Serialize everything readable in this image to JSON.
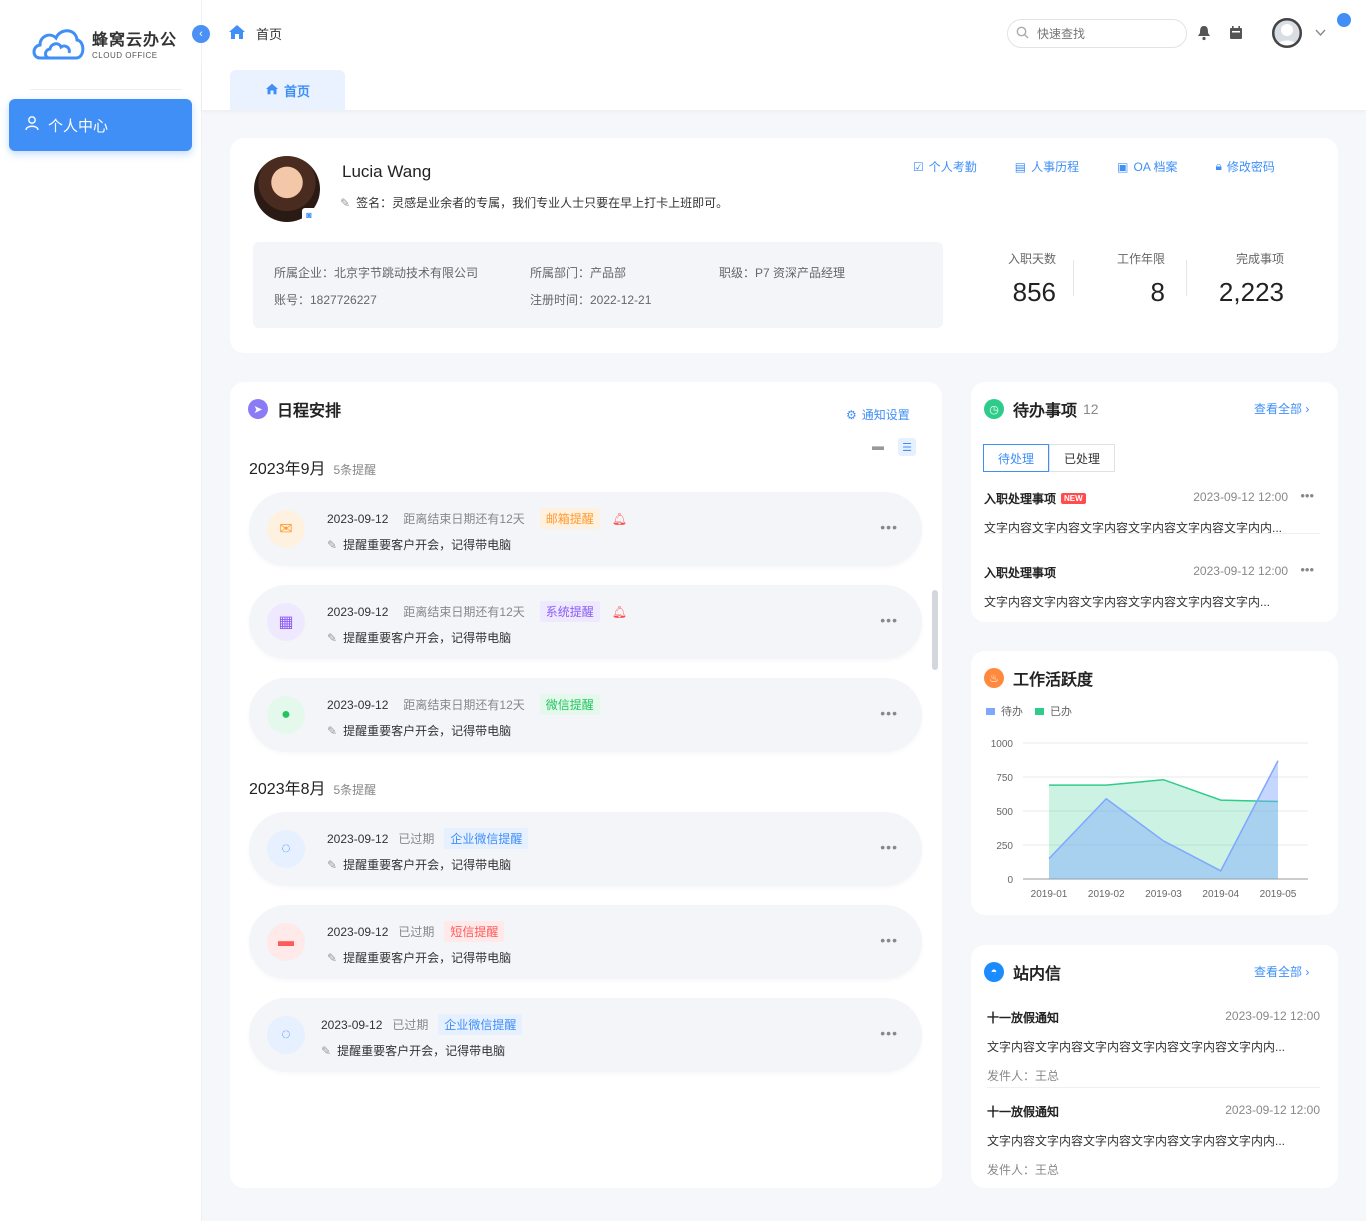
{
  "app": {
    "name_cn": "蜂窝云办公",
    "name_en": "CLOUD OFFICE"
  },
  "sidebar": {
    "items": [
      {
        "label": "个人中心",
        "icon": "user-icon",
        "active": true
      }
    ]
  },
  "header": {
    "breadcrumb": "首页",
    "search_placeholder": "快速查找"
  },
  "tabs": [
    {
      "label": "首页",
      "active": true
    }
  ],
  "profile": {
    "name": "Lucia Wang",
    "signature": "签名：灵感是业余者的专属，我们专业人士只要在早上打卡上班即可。",
    "links": [
      "个人考勤",
      "人事历程",
      "OA 档案",
      "修改密码"
    ],
    "company": "所属企业：北京字节跳动技术有限公司",
    "department": "所属部门：产品部",
    "rank": "职级：P7 资深产品经理",
    "account": "账号：1827726227",
    "register": "注册时间：2022-12-21",
    "stats": [
      {
        "label": "入职天数",
        "value": "856"
      },
      {
        "label": "工作年限",
        "value": "8"
      },
      {
        "label": "完成事项",
        "value": "2,223"
      }
    ]
  },
  "schedule": {
    "title": "日程安排",
    "notify_label": "通知设置",
    "months": [
      {
        "title": "2023年9月",
        "count": "5条提醒"
      },
      {
        "title": "2023年8月",
        "count": "5条提醒"
      }
    ],
    "events": [
      {
        "date": "2023-09-12",
        "status": "距离结束日期还有12天",
        "tag": "邮箱提醒",
        "note": "提醒重要客户开会，记得带电脑",
        "icon": "mail-icon",
        "alarm": true,
        "color": "#ff9a2e"
      },
      {
        "date": "2023-09-12",
        "status": "距离结束日期还有12天",
        "tag": "系统提醒",
        "note": "提醒重要客户开会，记得带电脑",
        "icon": "apps-icon",
        "alarm": true,
        "color": "#8b5cf6"
      },
      {
        "date": "2023-09-12",
        "status": "距离结束日期还有12天",
        "tag": "微信提醒",
        "note": "提醒重要客户开会，记得带电脑",
        "icon": "wechat-icon",
        "alarm": false,
        "color": "#22c55e"
      },
      {
        "date": "2023-09-12",
        "status": "已过期",
        "tag": "企业微信提醒",
        "note": "提醒重要客户开会，记得带电脑",
        "icon": "wecom-icon",
        "alarm": false,
        "color": "#3f8ff7"
      },
      {
        "date": "2023-09-12",
        "status": "已过期",
        "tag": "短信提醒",
        "note": "提醒重要客户开会，记得带电脑",
        "icon": "sms-icon",
        "alarm": false,
        "color": "#ff5b5b"
      },
      {
        "date": "2023-09-12",
        "status": "已过期",
        "tag": "企业微信提醒",
        "note": "提醒重要客户开会，记得带电脑",
        "icon": "wecom-icon",
        "alarm": false,
        "color": "#3f8ff7"
      }
    ]
  },
  "todo": {
    "title": "待办事项",
    "count": "12",
    "see_all": "查看全部",
    "tabs": [
      "待处理",
      "已处理"
    ],
    "new_label": "NEW",
    "items": [
      {
        "title": "入职处理事项",
        "time": "2023-09-12 12:00",
        "content": "文字内容文字内容文字内容文字内容文字内容文字内内...",
        "new": true
      },
      {
        "title": "入职处理事项",
        "time": "2023-09-12 12:00",
        "content": "文字内容文字内容文字内容文字内容文字内容文字内...",
        "new": false
      }
    ]
  },
  "activity": {
    "title": "工作活跃度"
  },
  "chart_data": {
    "type": "area",
    "categories": [
      "2019-01",
      "2019-02",
      "2019-03",
      "2019-04",
      "2019-05"
    ],
    "series": [
      {
        "name": "待办",
        "values": [
          150,
          590,
          280,
          60,
          870
        ],
        "color": "#7fa7ff"
      },
      {
        "name": "已办",
        "values": [
          690,
          690,
          730,
          580,
          570
        ],
        "color": "#2ecc8a"
      }
    ],
    "ylim": [
      0,
      1000
    ],
    "yticks": [
      0,
      250,
      500,
      750,
      1000
    ],
    "grid": true,
    "legend": "top-left"
  },
  "mail": {
    "title": "站内信",
    "see_all": "查看全部",
    "items": [
      {
        "title": "十一放假通知",
        "time": "2023-09-12 12:00",
        "content": "文字内容文字内容文字内容文字内容文字内容文字内内...",
        "sender": "发件人：王总"
      },
      {
        "title": "十一放假通知",
        "time": "2023-09-12 12:00",
        "content": "文字内容文字内容文字内容文字内容文字内容文字内内...",
        "sender": "发件人：王总"
      }
    ]
  }
}
